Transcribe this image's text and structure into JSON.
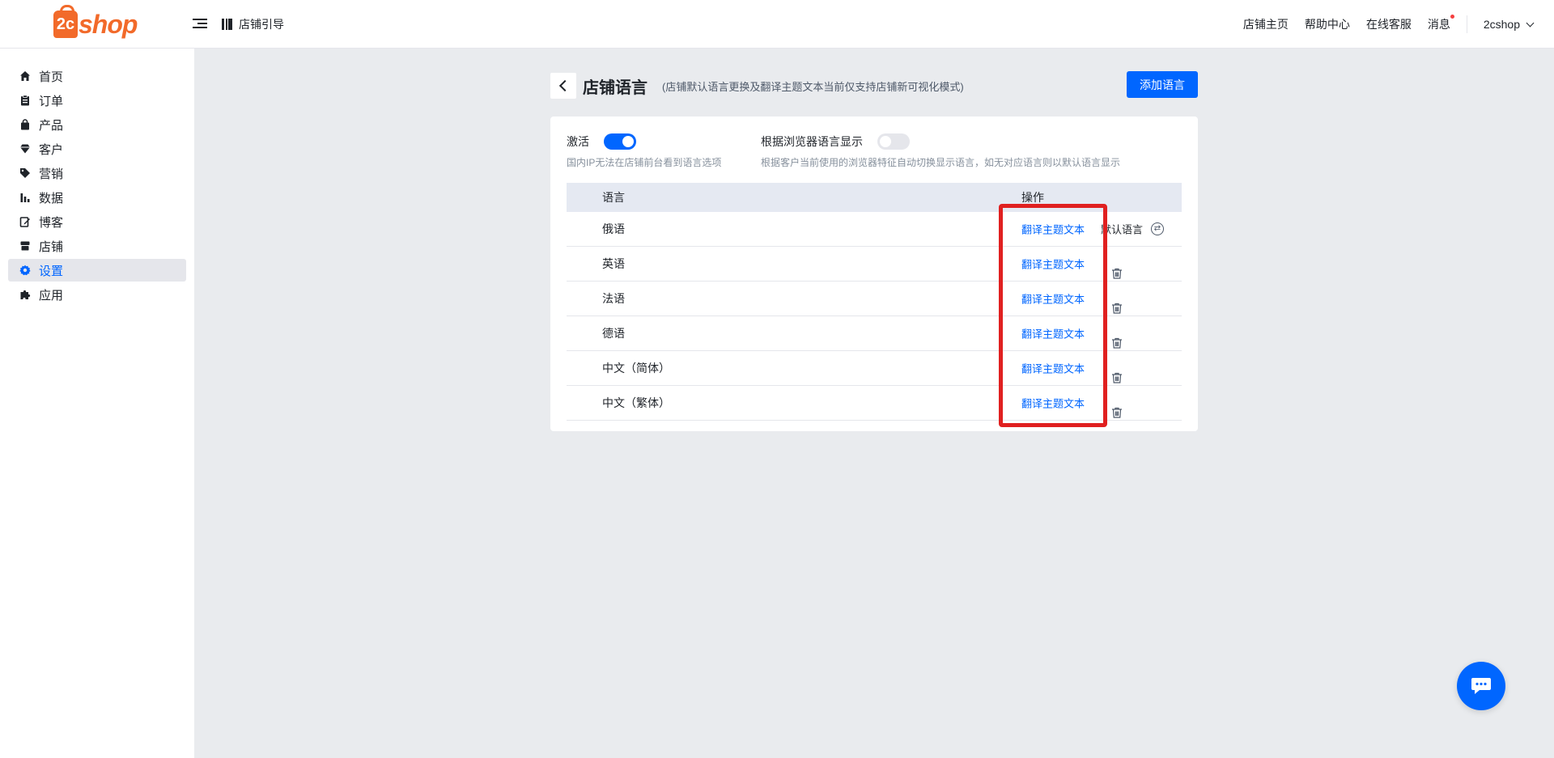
{
  "header": {
    "logo_mark": "2c",
    "logo_text": "shop",
    "guide_label": "店铺引导",
    "nav": [
      "店铺主页",
      "帮助中心",
      "在线客服",
      "消息"
    ],
    "user": "2cshop"
  },
  "sidebar": {
    "items": [
      {
        "label": "首页",
        "icon": "home-icon"
      },
      {
        "label": "订单",
        "icon": "clipboard-icon"
      },
      {
        "label": "产品",
        "icon": "bag-icon"
      },
      {
        "label": "客户",
        "icon": "diamond-icon"
      },
      {
        "label": "营销",
        "icon": "tag-icon"
      },
      {
        "label": "数据",
        "icon": "bar-chart-icon"
      },
      {
        "label": "博客",
        "icon": "edit-icon"
      },
      {
        "label": "店铺",
        "icon": "store-icon"
      },
      {
        "label": "设置",
        "icon": "gear-icon",
        "active": true
      },
      {
        "label": "应用",
        "icon": "puzzle-icon"
      }
    ]
  },
  "page": {
    "title": "店铺语言",
    "note": "(店铺默认语言更换及翻译主题文本当前仅支持店铺新可视化模式)",
    "add_button": "添加语言"
  },
  "settings": {
    "activate": {
      "label": "激活",
      "on": true,
      "desc": "国内IP无法在店铺前台看到语言选项"
    },
    "browser": {
      "label": "根据浏览器语言显示",
      "on": false,
      "desc": "根据客户当前使用的浏览器特征自动切换显示语言，如无对应语言则以默认语言显示"
    }
  },
  "table": {
    "headers": {
      "language": "语言",
      "operation": "操作"
    },
    "rows": [
      {
        "language": "俄语",
        "action": "翻译主题文本",
        "default_label": "默认语言"
      },
      {
        "language": "英语",
        "action": "翻译主题文本"
      },
      {
        "language": "法语",
        "action": "翻译主题文本"
      },
      {
        "language": "德语",
        "action": "翻译主题文本"
      },
      {
        "language": "中文（简体）",
        "action": "翻译主题文本"
      },
      {
        "language": "中文（繁体）",
        "action": "翻译主题文本"
      }
    ]
  },
  "colors": {
    "primary": "#0066ff",
    "brand": "#f26a2a",
    "highlight": "#e02020"
  }
}
